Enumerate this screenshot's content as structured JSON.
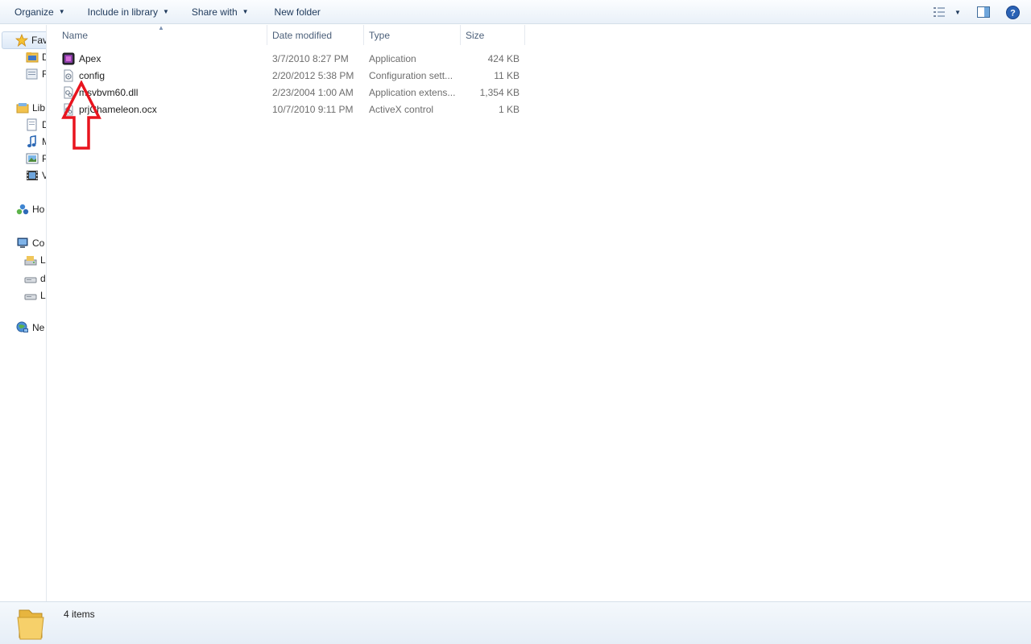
{
  "toolbar": {
    "organize": "Organize",
    "include_in_library": "Include in library",
    "share_with": "Share with",
    "new_folder": "New folder",
    "right_icons": [
      "view-options-icon",
      "chevron-down-icon",
      "preview-pane-icon",
      "help-icon"
    ]
  },
  "nav": {
    "items": [
      {
        "label": "Fav",
        "icon": "star-icon"
      },
      {
        "label": "D",
        "icon": "folder-icon"
      },
      {
        "label": "R",
        "icon": "recent-icon"
      },
      {
        "label": "Lib",
        "icon": "library-icon"
      },
      {
        "label": "D",
        "icon": "documents-icon"
      },
      {
        "label": "M",
        "icon": "music-icon"
      },
      {
        "label": "P",
        "icon": "pictures-icon"
      },
      {
        "label": "V",
        "icon": "videos-icon"
      },
      {
        "label": "Ho",
        "icon": "homegroup-icon"
      },
      {
        "label": "Co",
        "icon": "computer-icon"
      },
      {
        "label": "L",
        "icon": "drive-icon"
      },
      {
        "label": "d",
        "icon": "drive-icon"
      },
      {
        "label": "L",
        "icon": "drive-icon"
      },
      {
        "label": "Ne",
        "icon": "network-icon"
      }
    ]
  },
  "columns": {
    "name": "Name",
    "date": "Date modified",
    "type": "Type",
    "size": "Size"
  },
  "files": [
    {
      "name": "Apex",
      "date": "3/7/2010 8:27 PM",
      "type": "Application",
      "size": "424 KB",
      "icon": "application-icon"
    },
    {
      "name": "config",
      "date": "2/20/2012 5:38 PM",
      "type": "Configuration sett...",
      "size": "11 KB",
      "icon": "config-file-icon"
    },
    {
      "name": "msvbvm60.dll",
      "date": "2/23/2004 1:00 AM",
      "type": "Application extens...",
      "size": "1,354 KB",
      "icon": "dll-file-icon"
    },
    {
      "name": "prjChameleon.ocx",
      "date": "10/7/2010 9:11 PM",
      "type": "ActiveX control",
      "size": "1 KB",
      "icon": "ocx-file-icon"
    }
  ],
  "status": {
    "count": "4 items"
  },
  "colors": {
    "annotation": "#e8141e",
    "accent": "#1e395b"
  }
}
